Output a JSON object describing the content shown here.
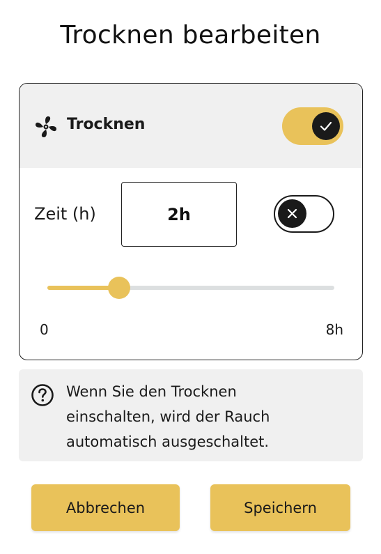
{
  "page": {
    "title": "Trocknen bearbeiten"
  },
  "colors": {
    "accent": "#e9c25a",
    "panel": "#f0f0f0",
    "dark": "#1a1a1a",
    "track": "#dcdfe0"
  },
  "card": {
    "header": {
      "icon": "fan-icon",
      "label": "Trocknen",
      "toggle": {
        "state": "on",
        "icon": "check-icon"
      }
    },
    "time": {
      "label": "Zeit (h)",
      "value": "2h",
      "toggle": {
        "state": "off",
        "icon": "close-icon"
      },
      "slider": {
        "min": 0,
        "max": 8,
        "value": 2,
        "min_label": "0",
        "max_label": "8h"
      }
    }
  },
  "info": {
    "icon": "help-circle-icon",
    "lines": [
      "Wenn Sie den Trocknen",
      "einschalten, wird der Rauch",
      "automatisch ausgeschaltet."
    ]
  },
  "buttons": {
    "cancel": "Abbrechen",
    "save": "Speichern"
  }
}
